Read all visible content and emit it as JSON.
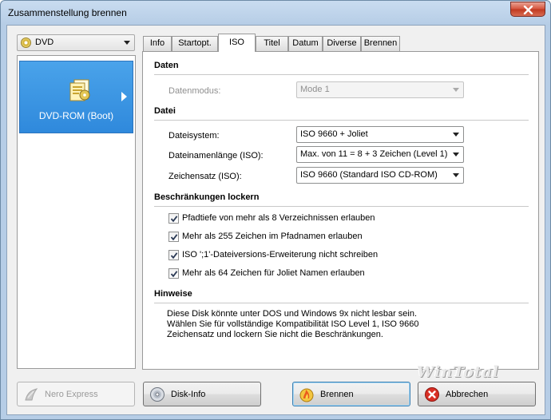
{
  "window": {
    "title": "Zusammenstellung brennen"
  },
  "left": {
    "disc_type": "DVD",
    "compilation_type": "DVD-ROM (Boot)"
  },
  "tabs": [
    {
      "label": "Info",
      "active": false
    },
    {
      "label": "Startopt.",
      "active": false
    },
    {
      "label": "ISO",
      "active": true
    },
    {
      "label": "Titel",
      "active": false
    },
    {
      "label": "Datum",
      "active": false
    },
    {
      "label": "Diverse",
      "active": false
    },
    {
      "label": "Brennen",
      "active": false
    }
  ],
  "iso": {
    "daten": {
      "heading": "Daten",
      "datenmodus_label": "Datenmodus:",
      "datenmodus_value": "Mode 1"
    },
    "datei": {
      "heading": "Datei",
      "dateisystem_label": "Dateisystem:",
      "dateisystem_value": "ISO 9660 + Joliet",
      "namelength_label": "Dateinamenlänge (ISO):",
      "namelength_value": "Max. von 11 = 8 + 3 Zeichen (Level 1)",
      "charset_label": "Zeichensatz (ISO):",
      "charset_value": "ISO 9660 (Standard ISO CD-ROM)"
    },
    "restrictions": {
      "heading": "Beschränkungen lockern",
      "items": [
        {
          "label": "Pfadtiefe von mehr als 8 Verzeichnissen erlauben",
          "checked": true
        },
        {
          "label": "Mehr als 255 Zeichen im Pfadnamen erlauben",
          "checked": true
        },
        {
          "label": "ISO ';1'-Dateiversions-Erweiterung nicht schreiben",
          "checked": true
        },
        {
          "label": "Mehr als 64 Zeichen für Joliet Namen erlauben",
          "checked": true
        }
      ]
    },
    "hints": {
      "heading": "Hinweise",
      "lines": [
        "Diese Disk könnte unter DOS und Windows 9x nicht lesbar sein.",
        "Wählen Sie für vollständige Kompatibilität ISO Level 1, ISO 9660",
        "Zeichensatz und lockern Sie nicht die Beschränkungen."
      ]
    }
  },
  "watermark": "WinTotal",
  "buttons": {
    "nero_express": "Nero Express",
    "disk_info": "Disk-Info",
    "brennen": "Brennen",
    "abbrechen": "Abbrechen"
  },
  "colors": {
    "selection": "#3a94e2",
    "titlebar": "#c4d8ee",
    "close_button": "#c8452c"
  }
}
